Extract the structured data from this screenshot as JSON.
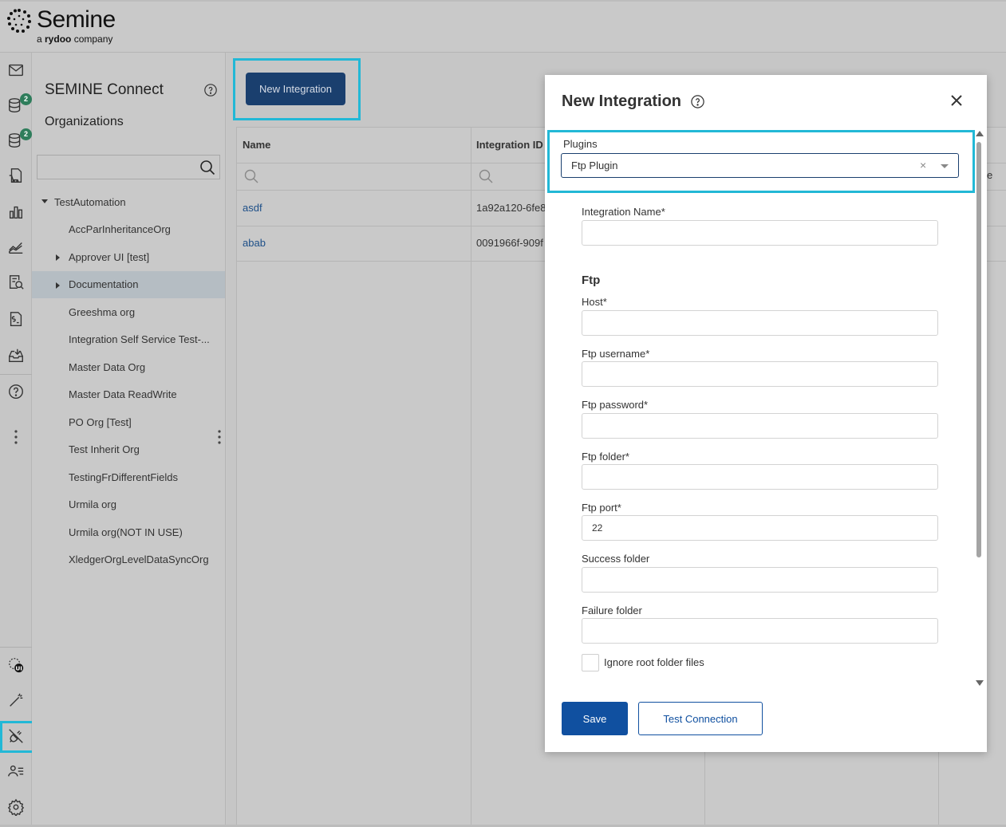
{
  "brand": {
    "name": "Semine",
    "tagline_prefix": "a ",
    "tagline_bold": "rydoo",
    "tagline_suffix": " company"
  },
  "rail": {
    "items": [
      {
        "icon": "mail-icon"
      },
      {
        "icon": "database-icon",
        "badge": "2"
      },
      {
        "icon": "database-icon",
        "badge": "2"
      },
      {
        "icon": "cart-doc-icon"
      },
      {
        "icon": "bar-chart-icon"
      },
      {
        "icon": "line-chart-icon"
      },
      {
        "icon": "search-doc-icon"
      },
      {
        "icon": "invoice-icon"
      },
      {
        "icon": "inbox-download-icon"
      },
      {
        "icon": "help-icon"
      },
      {
        "icon": "ui-settings-icon"
      },
      {
        "icon": "magic-wand-icon"
      },
      {
        "icon": "plug-icon",
        "active": true
      },
      {
        "icon": "users-list-icon"
      },
      {
        "icon": "gear-icon"
      }
    ]
  },
  "org_panel": {
    "title": "SEMINE Connect",
    "organizations_label": "Organizations",
    "search_placeholder": "",
    "tree": [
      {
        "label": "TestAutomation",
        "level": 0,
        "caret": "down"
      },
      {
        "label": "AccParInheritanceOrg",
        "level": 1,
        "caret": ""
      },
      {
        "label": "Approver UI [test]",
        "level": 1,
        "caret": "right"
      },
      {
        "label": "Documentation",
        "level": 1,
        "caret": "right",
        "selected": true
      },
      {
        "label": "Greeshma org",
        "level": 1,
        "caret": ""
      },
      {
        "label": "Integration Self Service Test-...",
        "level": 1,
        "caret": ""
      },
      {
        "label": "Master Data Org",
        "level": 1,
        "caret": ""
      },
      {
        "label": "Master Data ReadWrite",
        "level": 1,
        "caret": ""
      },
      {
        "label": "PO Org [Test]",
        "level": 1,
        "caret": ""
      },
      {
        "label": "Test Inherit Org",
        "level": 1,
        "caret": ""
      },
      {
        "label": "TestingFrDifferentFields",
        "level": 1,
        "caret": ""
      },
      {
        "label": "Urmila org",
        "level": 1,
        "caret": ""
      },
      {
        "label": "Urmila org(NOT IN USE)",
        "level": 1,
        "caret": ""
      },
      {
        "label": "XledgerOrgLevelDataSyncOrg",
        "level": 1,
        "caret": ""
      }
    ]
  },
  "main": {
    "new_integration_label": "New Integration",
    "columns": [
      "Name",
      "Integration ID",
      "",
      "e"
    ],
    "rows": [
      {
        "name": "asdf",
        "id": "1a92a120-6fe8"
      },
      {
        "name": "abab",
        "id": "0091966f-909f"
      }
    ]
  },
  "modal": {
    "title": "New Integration",
    "plugins_label": "Plugins",
    "plugin_value": "Ftp Plugin",
    "clear_symbol": "×",
    "integration_name_label": "Integration Name*",
    "section_title": "Ftp",
    "fields": [
      {
        "label": "Host*",
        "value": ""
      },
      {
        "label": "Ftp username*",
        "value": ""
      },
      {
        "label": "Ftp password*",
        "value": ""
      },
      {
        "label": "Ftp folder*",
        "value": ""
      },
      {
        "label": "Ftp port*",
        "value": "22"
      },
      {
        "label": "Success folder",
        "value": ""
      },
      {
        "label": "Failure folder",
        "value": ""
      }
    ],
    "ignore_root_label": "Ignore root folder files",
    "save_label": "Save",
    "test_connection_label": "Test Connection"
  },
  "colors": {
    "accent": "#1050a0",
    "highlight": "#22b8d6",
    "badge": "#2e7d5b"
  }
}
